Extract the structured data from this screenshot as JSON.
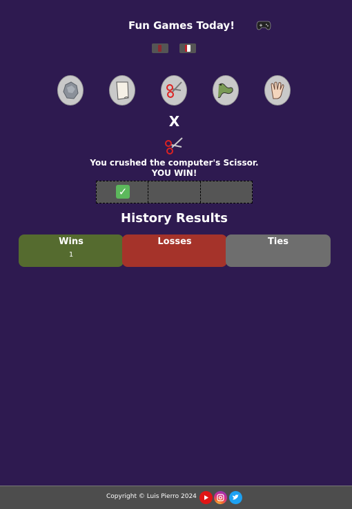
{
  "header": {
    "title": "Fun Games Today!",
    "gamepad_icon": "gamepad-icon"
  },
  "controls": {
    "buttons": [
      "stop-icon",
      "flag-icon"
    ]
  },
  "choices": [
    {
      "name": "Rock",
      "icon": "rock-icon"
    },
    {
      "name": "Paper",
      "icon": "paper-icon"
    },
    {
      "name": "Scissor",
      "icon": "scissors-icon"
    },
    {
      "name": "Lizard",
      "icon": "lizard-icon"
    },
    {
      "name": "Spock",
      "icon": "spock-hand-icon"
    }
  ],
  "versus": "X",
  "computer_choice_icon": "scissors-icon",
  "result": {
    "line1": "You crushed the computer's Scissor.",
    "line2": "YOU WIN!"
  },
  "rounds": [
    {
      "outcome": "win",
      "icon": "check-icon"
    },
    {
      "outcome": "",
      "icon": ""
    },
    {
      "outcome": "",
      "icon": ""
    }
  ],
  "history": {
    "title": "History Results",
    "wins_label": "Wins",
    "wins_value": "1",
    "losses_label": "Losses",
    "losses_value": "",
    "ties_label": "Ties",
    "ties_value": ""
  },
  "colors": {
    "background": "#2e1a50",
    "wins": "#556b2f",
    "losses": "#a5332a",
    "ties": "#6e6e6e",
    "footer": "#4d4d4d"
  },
  "footer": {
    "copyright": "Copyright © Luis Pierro 2024",
    "social": [
      "youtube-icon",
      "instagram-icon",
      "twitter-icon"
    ]
  }
}
